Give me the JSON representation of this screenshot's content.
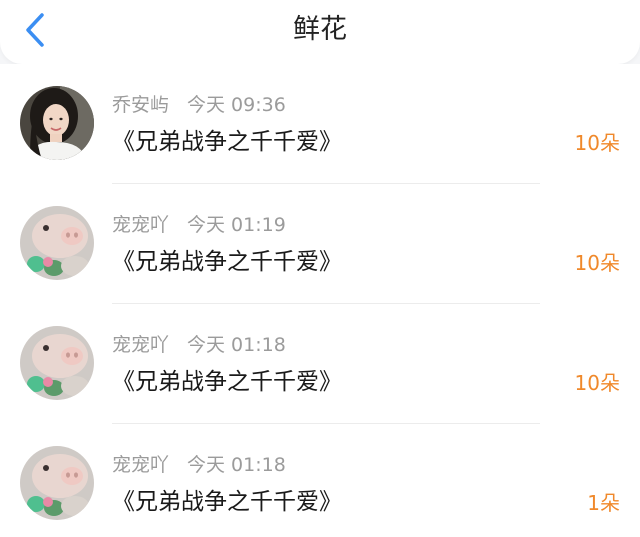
{
  "header": {
    "title": "鲜花",
    "back_icon": "chevron-left-icon",
    "accent": "#3b8ef2"
  },
  "colors": {
    "count": "#f0892b",
    "meta": "#9b9b9b",
    "title": "#1a1a1a"
  },
  "items": [
    {
      "name": "乔安屿",
      "time": "今天 09:36",
      "work": "《兄弟战争之千千爱》",
      "count": "10朵",
      "avatar": "avatar-woman"
    },
    {
      "name": "宠宠吖",
      "time": "今天 01:19",
      "work": "《兄弟战争之千千爱》",
      "count": "10朵",
      "avatar": "avatar-pig-plush"
    },
    {
      "name": "宠宠吖",
      "time": "今天 01:18",
      "work": "《兄弟战争之千千爱》",
      "count": "10朵",
      "avatar": "avatar-pig-plush"
    },
    {
      "name": "宠宠吖",
      "time": "今天 01:18",
      "work": "《兄弟战争之千千爱》",
      "count": "1朵",
      "avatar": "avatar-pig-plush"
    }
  ]
}
